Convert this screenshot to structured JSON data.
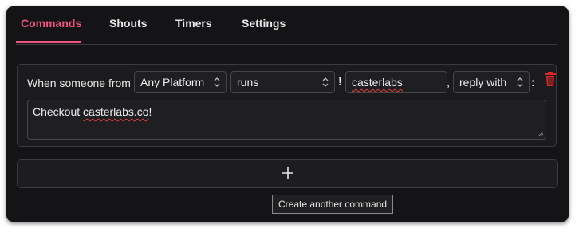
{
  "tabs": [
    {
      "label": "Commands",
      "active": true
    },
    {
      "label": "Shouts",
      "active": false
    },
    {
      "label": "Timers",
      "active": false
    },
    {
      "label": "Settings",
      "active": false
    }
  ],
  "command": {
    "prefix_text": "When someone from",
    "platform_select": "Any Platform",
    "action_select": "runs",
    "trigger_symbol": "!",
    "trigger_value": "casterlabs",
    "comma": ",",
    "response_select": "reply with",
    "colon": ":",
    "response_text": "Checkout casterlabs.co!"
  },
  "add_button": {
    "icon": "plus-icon",
    "tooltip": "Create another command"
  },
  "icons": {
    "delete": "trash-icon",
    "select": "chevron-updown-icon"
  },
  "colors": {
    "accent": "#f2537c",
    "delete": "#e02424",
    "background": "#141416"
  }
}
